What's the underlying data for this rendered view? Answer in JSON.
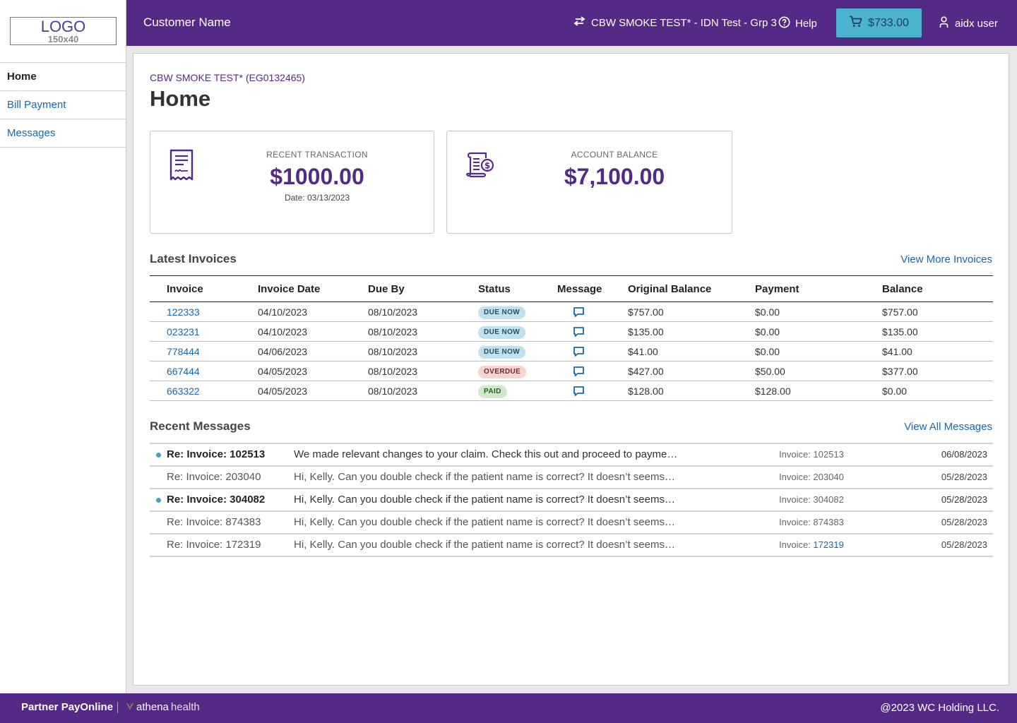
{
  "brand": {
    "logo_text": "LOGO",
    "logo_size": "150x40",
    "primary_color": "#542a87",
    "accent_color": "#4cb3cf",
    "link_color": "#1a67a8"
  },
  "sidebar": {
    "items": [
      {
        "label": "Home",
        "active": true
      },
      {
        "label": "Bill Payment",
        "active": false
      },
      {
        "label": "Messages",
        "active": false
      }
    ]
  },
  "topbar": {
    "customer_name": "Customer Name",
    "org_switch_label": "CBW SMOKE TEST* - IDN Test - Grp 3",
    "help_label": "Help",
    "cart_total": "$733.00",
    "user_name": "aidx user"
  },
  "main": {
    "account_code": "CBW SMOKE TEST* (EG0132465)",
    "title": "Home",
    "recent_transaction": {
      "label": "RECENT TRANSACTION",
      "value": "$1000.00",
      "date": "Date: 03/13/2023"
    },
    "account_balance": {
      "label": "ACCOUNT BALANCE",
      "value": "$7,100.00"
    }
  },
  "invoices": {
    "title": "Latest Invoices",
    "view_more": "View More Invoices",
    "headers": [
      "Invoice",
      "Invoice Date",
      "Due By",
      "Status",
      "Message",
      "Original Balance",
      "Payment",
      "Balance"
    ],
    "rows": [
      {
        "invoice": "122333",
        "date": "04/10/2023",
        "due": "08/10/2023",
        "status": "DUE NOW",
        "status_type": "due",
        "original": "$757.00",
        "payment": "$0.00",
        "balance": "$757.00"
      },
      {
        "invoice": "023231",
        "date": "04/10/2023",
        "due": "08/10/2023",
        "status": "DUE NOW",
        "status_type": "due",
        "original": "$135.00",
        "payment": "$0.00",
        "balance": "$135.00"
      },
      {
        "invoice": "778444",
        "date": "04/06/2023",
        "due": "08/10/2023",
        "status": "DUE NOW",
        "status_type": "due",
        "original": "$41.00",
        "payment": "$0.00",
        "balance": "$41.00"
      },
      {
        "invoice": "667444",
        "date": "04/05/2023",
        "due": "08/10/2023",
        "status": "OVERDUE",
        "status_type": "overdue",
        "original": "$427.00",
        "payment": "$50.00",
        "balance": "$377.00"
      },
      {
        "invoice": "663322",
        "date": "04/05/2023",
        "due": "08/10/2023",
        "status": "PAID",
        "status_type": "paid",
        "original": "$128.00",
        "payment": "$128.00",
        "balance": "$0.00"
      }
    ]
  },
  "messages": {
    "title": "Recent Messages",
    "view_all": "View All Messages",
    "rows": [
      {
        "unread": true,
        "subject": "Re: Invoice: 102513",
        "body": "We made relevant changes to your claim. Check this out and proceed to payme…",
        "invoice_prefix": "Invoice: ",
        "invoice": "102513",
        "invoice_link": false,
        "date": "06/08/2023"
      },
      {
        "unread": false,
        "subject": "Re: Invoice: 203040",
        "body": "Hi, Kelly. Can you double check if the patient name is correct? It doesn’t seems…",
        "invoice_prefix": "Invoice: ",
        "invoice": "203040",
        "invoice_link": false,
        "date": "05/28/2023"
      },
      {
        "unread": true,
        "subject": "Re: Invoice: 304082",
        "body": "Hi, Kelly. Can you double check if the patient name is correct? It doesn’t seems…",
        "invoice_prefix": "Invoice: ",
        "invoice": "304082",
        "invoice_link": false,
        "date": "05/28/2023"
      },
      {
        "unread": false,
        "subject": "Re: Invoice: 874383",
        "body": "Hi, Kelly. Can you double check if the patient name is correct? It doesn’t seems…",
        "invoice_prefix": "Invoice: ",
        "invoice": "874383",
        "invoice_link": false,
        "date": "05/28/2023"
      },
      {
        "unread": false,
        "subject": "Re: Invoice: 172319",
        "body": "Hi, Kelly. Can you double check if the patient name is correct? It doesn’t seems…",
        "invoice_prefix": "Invoice: ",
        "invoice": "172319",
        "invoice_link": true,
        "date": "05/28/2023"
      }
    ]
  },
  "footer": {
    "brand": "Partner PayOnline",
    "partner_a": "athena",
    "partner_b": "health",
    "copyright": "@2023 WC Holding LLC."
  }
}
